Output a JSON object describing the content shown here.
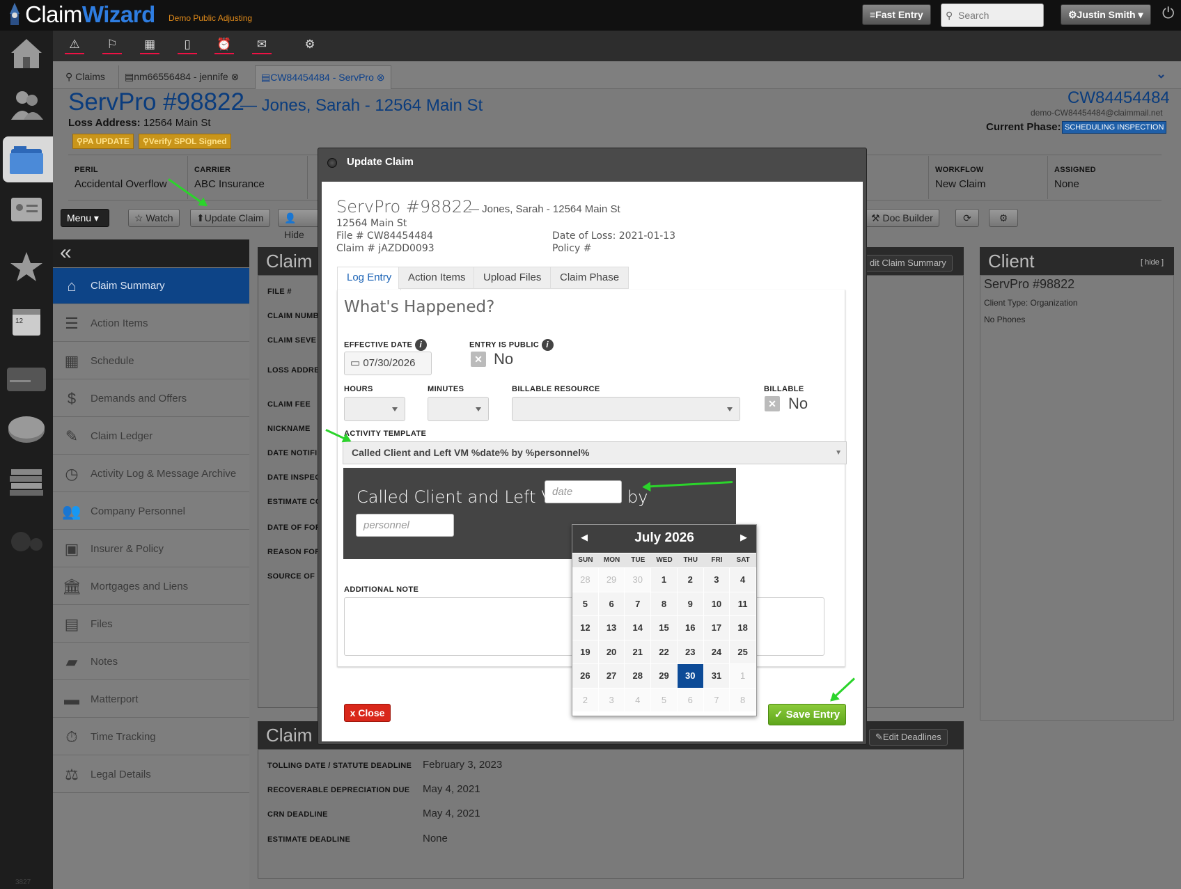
{
  "app": {
    "brand_claim": "Claim",
    "brand_wizard": "Wizard",
    "company": "Demo Public Adjusting"
  },
  "topbar": {
    "fast_entry": "≡Fast Entry",
    "search_placeholder": "Search",
    "user": "⚙Justin Smith ▾"
  },
  "tabs": [
    {
      "label": "Claims"
    },
    {
      "label": "nm66556484 - jennife"
    },
    {
      "label": "CW84454484 - ServPro"
    }
  ],
  "header": {
    "title": "ServPro #98822",
    "subtitle": "— Jones, Sarah - 12564 Main St",
    "loss_address_label": "Loss Address:",
    "loss_address": "12564 Main St",
    "pills": [
      "PA UPDATE",
      "Verify SPOL Signed"
    ],
    "claim_number": "CW84454484",
    "email": "demo-CW84454484@claimmail.net",
    "phase_label": "Current Phase:",
    "phase": "SCHEDULING INSPECTION"
  },
  "info": {
    "peril_label": "PERIL",
    "peril": "Accidental Overflow",
    "carrier_label": "CARRIER",
    "carrier": "ABC Insurance",
    "workflow_label": "WORKFLOW",
    "workflow": "New Claim",
    "assigned_label": "ASSIGNED",
    "assigned": "None"
  },
  "buttons": {
    "menu": "Menu ▾",
    "watch": "☆ Watch",
    "update_claim": "⬆Update Claim",
    "hide": "Hide",
    "doc_builder": "Doc Builder",
    "edit_summary": "dit Claim Summary",
    "edit_deadlines": "Edit Deadlines"
  },
  "sidenav": [
    {
      "label": "Claim Summary"
    },
    {
      "label": "Action Items"
    },
    {
      "label": "Schedule"
    },
    {
      "label": "Demands and Offers"
    },
    {
      "label": "Claim Ledger"
    },
    {
      "label": "Activity Log & Message Archive"
    },
    {
      "label": "Company Personnel"
    },
    {
      "label": "Insurer & Policy"
    },
    {
      "label": "Mortgages and Liens"
    },
    {
      "label": "Files"
    },
    {
      "label": "Notes"
    },
    {
      "label": "Matterport"
    },
    {
      "label": "Time Tracking"
    },
    {
      "label": "Legal Details"
    }
  ],
  "summary_panel": {
    "title": "Claim S",
    "fields": [
      "FILE #",
      "CLAIM NUMB",
      "CLAIM SEVE",
      "LOSS ADDRE",
      "CLAIM FEE",
      "NICKNAME",
      "DATE NOTIFI",
      "DATE INSPEC",
      "ESTIMATE CO",
      "DATE OF FOR",
      "REASON FOR",
      "SOURCE OF"
    ]
  },
  "client_panel": {
    "title": "Client",
    "hide": "[ hide ]",
    "name": "ServPro #98822",
    "type": "Client Type: Organization",
    "phones": "No Phones"
  },
  "deadlines_panel": {
    "title": "Claim D",
    "rows": [
      {
        "label": "TOLLING DATE / STATUTE DEADLINE",
        "value": "February 3, 2023"
      },
      {
        "label": "RECOVERABLE DEPRECIATION DUE",
        "value": "May 4, 2021"
      },
      {
        "label": "CRN DEADLINE",
        "value": "May 4, 2021"
      },
      {
        "label": "ESTIMATE DEADLINE",
        "value": "None"
      }
    ]
  },
  "modal": {
    "title": "Update Claim",
    "claim_title": "ServPro #98822",
    "claim_sub": "— Jones, Sarah - 12564 Main St",
    "address": "12564 Main St",
    "file": "File # CW84454484",
    "claim_no": "Claim # jAZDD0093",
    "date_of_loss": "Date of Loss: 2021-01-13",
    "policy": "Policy #",
    "tabs": [
      "Log Entry",
      "Action Items",
      "Upload Files",
      "Claim Phase"
    ],
    "heading": "What's Happened?",
    "effective_date_label": "EFFECTIVE DATE",
    "effective_date": "07/30/2026",
    "entry_public_label": "ENTRY IS PUBLIC",
    "entry_public": "No",
    "hours_label": "HOURS",
    "minutes_label": "MINUTES",
    "billable_resource_label": "BILLABLE RESOURCE",
    "billable_label": "BILLABLE",
    "billable": "No",
    "template_label": "ACTIVITY TEMPLATE",
    "template": "Called Client and Left VM %date% by %personnel%",
    "template_text": "Called Client and Left VM",
    "template_by": "by",
    "date_placeholder": "date",
    "personnel_placeholder": "personnel",
    "note_label": "ADDITIONAL NOTE",
    "close": "x Close",
    "save": "✓ Save Entry"
  },
  "calendar": {
    "month": "July 2026",
    "dow": [
      "SUN",
      "MON",
      "TUE",
      "WED",
      "THU",
      "FRI",
      "SAT"
    ],
    "selected": "30"
  },
  "footer": {
    "code": "3827"
  }
}
